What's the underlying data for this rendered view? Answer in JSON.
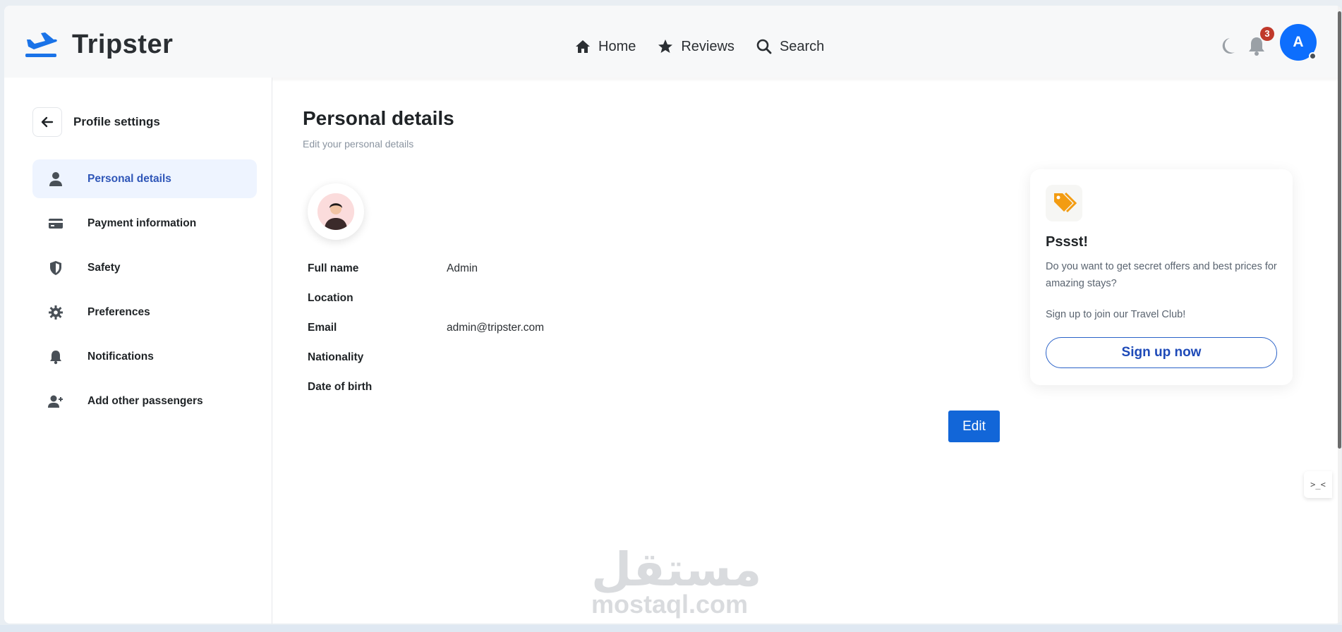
{
  "app": {
    "name": "Tripster"
  },
  "nav": [
    {
      "label": "Home",
      "icon": "home-icon"
    },
    {
      "label": "Reviews",
      "icon": "star-icon"
    },
    {
      "label": "Search",
      "icon": "search-icon"
    }
  ],
  "header": {
    "notification_count": "3",
    "avatar_initial": "A"
  },
  "sidebar": {
    "title": "Profile settings",
    "items": [
      {
        "label": "Personal details",
        "icon": "user-icon",
        "active": true
      },
      {
        "label": "Payment information",
        "icon": "credit-card-icon"
      },
      {
        "label": "Safety",
        "icon": "shield-icon"
      },
      {
        "label": "Preferences",
        "icon": "gear-icon"
      },
      {
        "label": "Notifications",
        "icon": "bell-icon"
      },
      {
        "label": "Add other passengers",
        "icon": "user-plus-icon"
      }
    ]
  },
  "main": {
    "title": "Personal details",
    "subtitle": "Edit your personal details",
    "fields": [
      {
        "label": "Full name",
        "value": "Admin"
      },
      {
        "label": "Location",
        "value": ""
      },
      {
        "label": "Email",
        "value": "admin@tripster.com"
      },
      {
        "label": "Nationality",
        "value": ""
      },
      {
        "label": "Date of birth",
        "value": ""
      }
    ],
    "edit_label": "Edit"
  },
  "promo": {
    "title": "Pssst!",
    "text": "Do you want to get secret offers and best prices for amazing stays?",
    "cta_text": "Sign up to join our Travel Club!",
    "button_label": "Sign up now"
  },
  "watermark": {
    "arabic": "مستقل",
    "latin": "mostaql.com"
  },
  "colors": {
    "accent": "#1266d8",
    "brand_icon": "#1a73e8",
    "badge": "#c0392b",
    "promo_icon": "#f39c12"
  }
}
